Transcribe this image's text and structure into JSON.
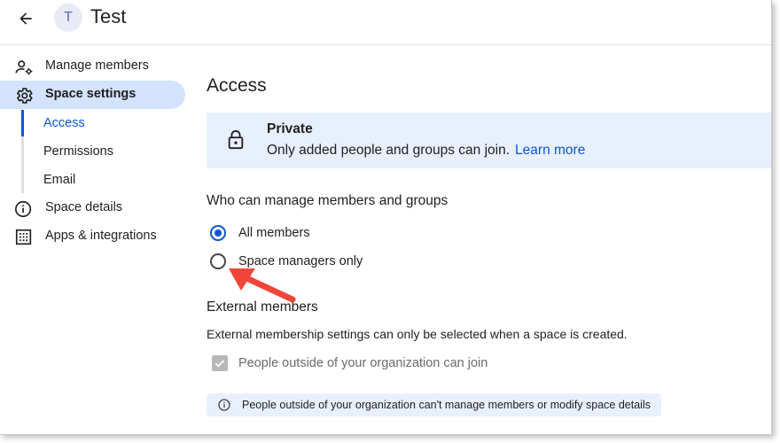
{
  "header": {
    "avatar_letter": "T",
    "title": "Test"
  },
  "sidebar": {
    "items": [
      {
        "label": "Manage members",
        "icon": "manage-members-icon"
      },
      {
        "label": "Space settings",
        "icon": "gear-icon",
        "active": true
      },
      {
        "label": "Space details",
        "icon": "info-icon"
      },
      {
        "label": "Apps & integrations",
        "icon": "apps-grid-icon"
      }
    ],
    "subitems": [
      {
        "label": "Access",
        "active": true
      },
      {
        "label": "Permissions"
      },
      {
        "label": "Email"
      }
    ]
  },
  "main": {
    "title": "Access",
    "privacy_card": {
      "title": "Private",
      "description": "Only added people and groups can join.",
      "link": "Learn more"
    },
    "manage_section": {
      "heading": "Who can manage members and groups",
      "options": [
        {
          "label": "All members",
          "selected": true
        },
        {
          "label": "Space managers only",
          "selected": false
        }
      ]
    },
    "external_section": {
      "heading": "External members",
      "description": "External membership settings can only be selected when a space is created.",
      "checkbox_label": "People outside of your organization can join",
      "checkbox_checked": true,
      "checkbox_disabled": true,
      "notice": "People outside of your organization can't manage members or modify space details"
    }
  },
  "colors": {
    "accent": "#0b57d0",
    "active_bg": "#d3e3fd",
    "card_bg": "#e8f0fe",
    "annotation_arrow": "#f0453a"
  }
}
